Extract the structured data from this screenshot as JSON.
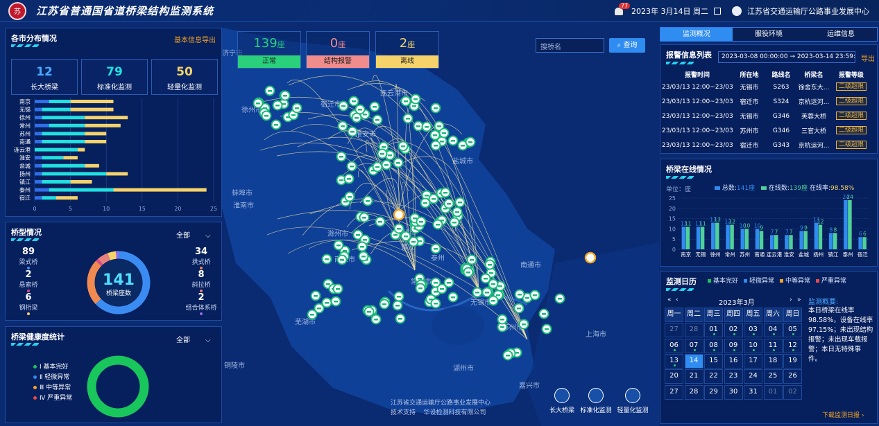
{
  "header": {
    "title": "江苏省普通国省道桥梁结构监测系统",
    "logo_text": "苏",
    "notif_count": "77",
    "date": "2023年 3月14日 周二",
    "org": "江苏省交通运输厅公路事业发展中心"
  },
  "city_dist": {
    "title": "各市分布情况",
    "export": "基本信息导出",
    "stats": [
      {
        "value": "12",
        "label": "长大桥梁",
        "color": "#4aa8ff"
      },
      {
        "value": "79",
        "label": "标准化监测",
        "color": "#22e0e0"
      },
      {
        "value": "50",
        "label": "轻量化监测",
        "color": "#f5d36a"
      }
    ]
  },
  "chart_data": [
    {
      "type": "bar",
      "orientation": "horizontal-stacked",
      "categories": [
        "南京",
        "无锡",
        "徐州",
        "常州",
        "苏州",
        "南通",
        "连云港",
        "淮安",
        "盐城",
        "扬州",
        "镇江",
        "泰州",
        "宿迁"
      ],
      "series": [
        {
          "color": "#2f6fe8",
          "values": [
            2,
            1,
            1,
            2,
            1,
            1,
            0,
            1,
            1,
            1,
            1,
            2,
            1
          ]
        },
        {
          "color": "#22e0e0",
          "values": [
            3,
            4,
            6,
            5,
            6,
            6,
            6,
            3,
            6,
            9,
            4,
            9,
            2
          ]
        },
        {
          "color": "#f5d36a",
          "values": [
            6,
            6,
            6,
            5,
            3,
            3,
            1,
            2,
            2,
            3,
            3,
            13,
            3
          ]
        }
      ],
      "xticks": [
        "0",
        "5",
        "10",
        "15",
        "20",
        "25"
      ],
      "xlim": [
        0,
        25
      ]
    },
    {
      "type": "bar",
      "title": "桥梁在线情况",
      "categories": [
        "南京",
        "无锡",
        "徐州",
        "常州",
        "苏州",
        "南通",
        "连云港",
        "淮安",
        "盐城",
        "扬州",
        "镇江",
        "泰州",
        "宿迁"
      ],
      "series": [
        {
          "name": "总数",
          "color": "#2f8cf0",
          "values": [
            11,
            11,
            13,
            12,
            10,
            10,
            7,
            7,
            9,
            13,
            8,
            24,
            6
          ]
        },
        {
          "name": "在线数",
          "color": "#4fd19a",
          "values": [
            11,
            11,
            13,
            12,
            10,
            9,
            7,
            7,
            9,
            12,
            8,
            24,
            6
          ]
        }
      ],
      "yticks": [
        "0",
        "5",
        "10",
        "15",
        "20",
        "25"
      ],
      "ylim": [
        0,
        25
      ],
      "unit": "单位：座"
    },
    {
      "type": "pie",
      "title": "桥型情况",
      "total": "141",
      "total_label": "桥梁座数",
      "slices": [
        {
          "name": "梁式桥",
          "value": 89,
          "color": "#3b8cf2"
        },
        {
          "name": "拱式桥",
          "value": 34,
          "color": "#f08a50"
        },
        {
          "name": "悬索桥",
          "value": 2,
          "color": "#d94a8c"
        },
        {
          "name": "斜拉桥",
          "value": 8,
          "color": "#e88080"
        },
        {
          "name": "钢桁梁",
          "value": 6,
          "color": "#f5d36a"
        },
        {
          "name": "组合体系桥",
          "value": 2,
          "color": "#9b6cf0"
        }
      ]
    },
    {
      "type": "pie",
      "title": "桥梁健康度统计",
      "slices": [
        {
          "name": "Ⅰ 基本完好",
          "value": 141,
          "color": "#19c65c"
        },
        {
          "name": "Ⅱ 轻微异常",
          "value": 0,
          "color": "#2f8cf0"
        },
        {
          "name": "Ⅲ 中等异常",
          "value": 0,
          "color": "#f5a623"
        },
        {
          "name": "Ⅳ 严重异常",
          "value": 0,
          "color": "#e84a4a"
        }
      ]
    }
  ],
  "bridge_type": {
    "title": "桥型情况",
    "filter": "全部",
    "left": [
      {
        "value": "89",
        "label": "梁式桥",
        "color": "#3b8cf2"
      },
      {
        "value": "2",
        "label": "悬索桥",
        "color": "#d94a8c"
      },
      {
        "value": "6",
        "label": "钢桁梁",
        "color": "#f5d36a"
      }
    ],
    "right": [
      {
        "value": "34",
        "label": "拱式桥",
        "color": "#f08a50"
      },
      {
        "value": "8",
        "label": "斜拉桥",
        "color": "#e88080"
      },
      {
        "value": "2",
        "label": "组合体系桥",
        "color": "#9b6cf0"
      }
    ]
  },
  "health": {
    "title": "桥梁健康度统计",
    "filter": "全部"
  },
  "top_stats": [
    {
      "value": "139",
      "unit": "座",
      "label": "正常",
      "color": "#2ad07c",
      "text": "#2ad07c"
    },
    {
      "value": "0",
      "unit": "座",
      "label": "结构报警",
      "color": "#f08c8c",
      "text": "#f08c8c"
    },
    {
      "value": "2",
      "unit": "座",
      "label": "离线",
      "color": "#f5d36a",
      "text": "#f5d36a"
    }
  ],
  "search": {
    "placeholder": "搜桥名",
    "button": "查询"
  },
  "map_labels": [
    "济宁市",
    "徐州市",
    "连云港市",
    "宿迁市",
    "淮安市",
    "盐城市",
    "蚌埠市",
    "淮南市",
    "滁州市",
    "扬州市",
    "镇江",
    "南京市",
    "泰州",
    "南通市",
    "常州市",
    "无锡市",
    "苏州市",
    "芜湖市",
    "铜陵市",
    "湖州市",
    "嘉兴市",
    "上海市"
  ],
  "footer": {
    "line1": "江苏省交通运输厅公路事业发展中心",
    "line2": "技术支持    华设检测科技有限公司"
  },
  "legend_icons": [
    "长大桥梁",
    "标准化监测",
    "轻量化监测"
  ],
  "tabs": [
    "监测概况",
    "服役环境",
    "运维信息"
  ],
  "alarm": {
    "title": "报警信息列表",
    "date_from": "2023-03-08 00:00:00",
    "date_to": "2023-03-14 23:59:59",
    "export": "导出",
    "columns": [
      "报警时间",
      "所在地",
      "路线名",
      "桥梁名",
      "报警等级"
    ],
    "rows": [
      [
        "23/03/13 12:00~23/03/13...",
        "无锡市",
        "S263",
        "徐舍东大...",
        "二级超限"
      ],
      [
        "23/03/13 12:00~23/03/13...",
        "宿迁市",
        "S324",
        "京杭运河...",
        "二级超限"
      ],
      [
        "23/03/13 12:00~23/03/13...",
        "无锡市",
        "G346",
        "芙蓉大桥",
        "二级超限"
      ],
      [
        "23/03/13 12:00~23/03/13...",
        "苏州市",
        "G346",
        "三官大桥",
        "二级超限"
      ],
      [
        "23/03/13 12:00~23/03/13...",
        "宿迁市",
        "G343",
        "京杭运河...",
        "二级超限"
      ]
    ]
  },
  "online": {
    "title": "桥梁在线情况",
    "unit": "单位：座",
    "total_label": "总数:",
    "total": "141座",
    "online_label": "在线数:",
    "online": "139座",
    "rate_label": "在线率:",
    "rate": "98.58%"
  },
  "calendar": {
    "title": "监测日历",
    "legend": [
      {
        "label": "基本完好",
        "color": "#19c65c"
      },
      {
        "label": "轻微异常",
        "color": "#2f8cf0"
      },
      {
        "label": "中等异常",
        "color": "#f5a623"
      },
      {
        "label": "严重异常",
        "color": "#e84a4a"
      }
    ],
    "month": "2023年3月",
    "weekdays": [
      "周一",
      "周二",
      "周三",
      "周四",
      "周五",
      "周六",
      "周日"
    ],
    "summary_title": "监测概要:",
    "summary": "本日桥梁在线率98.58%，设备在线率97.15%；未出现结构报警；未出现车载报警；本日无特殊事件。",
    "download": "下载监测日报"
  }
}
